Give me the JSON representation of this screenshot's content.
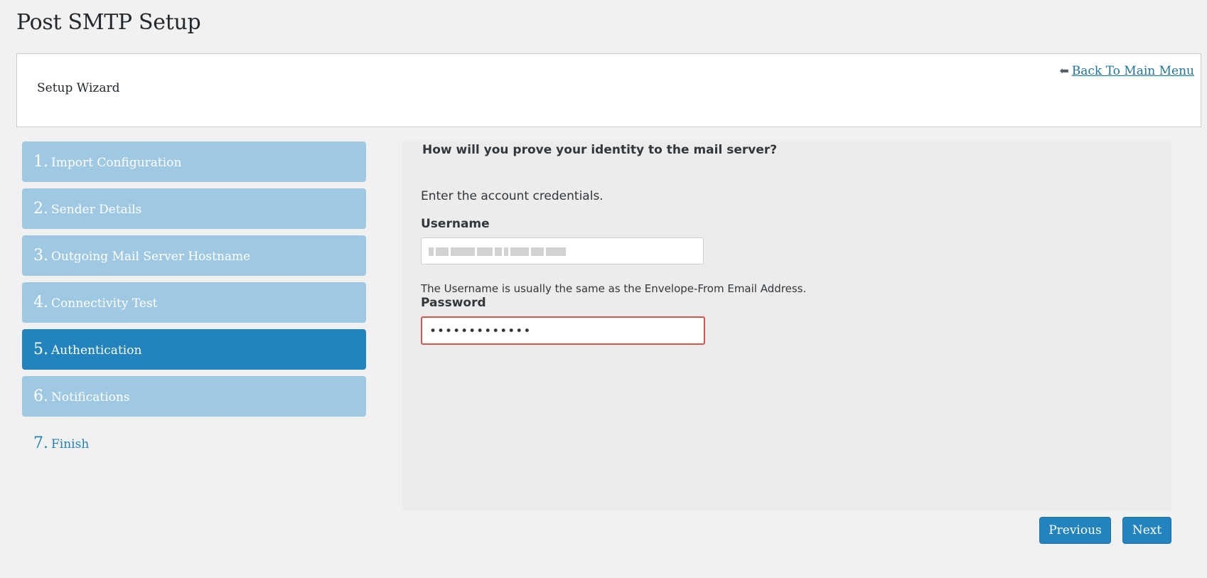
{
  "page": {
    "title": "Post SMTP Setup"
  },
  "wizard": {
    "label": "Setup Wizard",
    "back_link": "Back To Main Menu",
    "back_icon": "left-arrow-icon"
  },
  "steps": [
    {
      "num": "1.",
      "label": "Import Configuration",
      "state": "completed"
    },
    {
      "num": "2.",
      "label": "Sender Details",
      "state": "completed"
    },
    {
      "num": "3.",
      "label": "Outgoing Mail Server Hostname",
      "state": "completed"
    },
    {
      "num": "4.",
      "label": "Connectivity Test",
      "state": "completed"
    },
    {
      "num": "5.",
      "label": "Authentication",
      "state": "active"
    },
    {
      "num": "6.",
      "label": "Notifications",
      "state": "completed"
    },
    {
      "num": "7.",
      "label": "Finish",
      "state": "pending"
    }
  ],
  "auth": {
    "question": "How will you prove your identity to the mail server?",
    "intro": "Enter the account credentials.",
    "username_label": "Username",
    "username_value": "",
    "username_help": "The Username is usually the same as the Envelope-From Email Address.",
    "password_label": "Password",
    "password_value": "•••••••••••••"
  },
  "buttons": {
    "previous": "Previous",
    "next": "Next"
  },
  "colors": {
    "active_step": "#2283bf",
    "completed_step": "#9fc9e2",
    "link": "#21759b",
    "error_border": "#d9534f"
  }
}
